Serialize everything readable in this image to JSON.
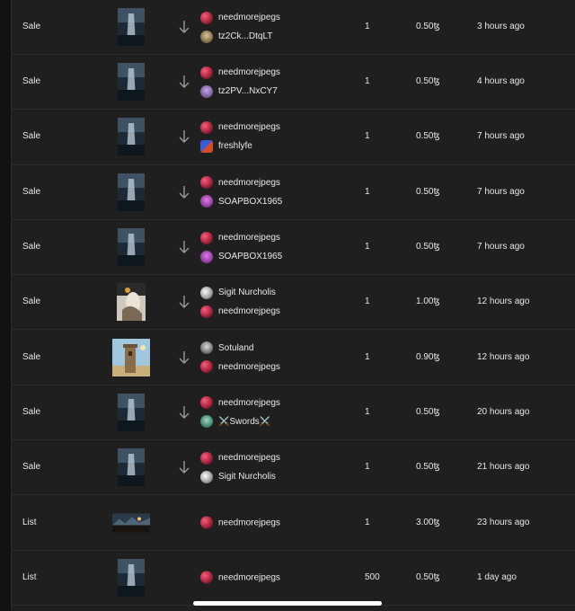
{
  "colors": {
    "background": "#1f1f1f",
    "text": "#e8e8e8",
    "divider": "#2e2e2e"
  },
  "rows": [
    {
      "event": "Sale",
      "artwork": "waterfall-artwork",
      "from": "needmorejpegs",
      "from_avatar": "av-need",
      "to": "tz2Ck...DtqLT",
      "to_avatar": "av-tz2ck",
      "qty": "1",
      "price": "0.50ꜩ",
      "time": "3 hours ago"
    },
    {
      "event": "Sale",
      "artwork": "waterfall-artwork",
      "from": "needmorejpegs",
      "from_avatar": "av-need",
      "to": "tz2PV...NxCY7",
      "to_avatar": "av-tz2pv",
      "qty": "1",
      "price": "0.50ꜩ",
      "time": "4 hours ago"
    },
    {
      "event": "Sale",
      "artwork": "waterfall-artwork",
      "from": "needmorejpegs",
      "from_avatar": "av-need",
      "to": "freshlyfe",
      "to_avatar": "av-fresh",
      "qty": "1",
      "price": "0.50ꜩ",
      "time": "7 hours ago"
    },
    {
      "event": "Sale",
      "artwork": "waterfall-artwork",
      "from": "needmorejpegs",
      "from_avatar": "av-need",
      "to": "SOAPBOX1965",
      "to_avatar": "av-soap",
      "qty": "1",
      "price": "0.50ꜩ",
      "time": "7 hours ago"
    },
    {
      "event": "Sale",
      "artwork": "waterfall-artwork",
      "from": "needmorejpegs",
      "from_avatar": "av-need",
      "to": "SOAPBOX1965",
      "to_avatar": "av-soap",
      "qty": "1",
      "price": "0.50ꜩ",
      "time": "7 hours ago"
    },
    {
      "event": "Sale",
      "artwork": "portrait-artwork",
      "from": "Sigit Nurcholis",
      "from_avatar": "av-sigit",
      "to": "needmorejpegs",
      "to_avatar": "av-need",
      "qty": "1",
      "price": "1.00ꜩ",
      "time": "12 hours ago"
    },
    {
      "event": "Sale",
      "artwork": "tower-artwork",
      "from": "Sotuland",
      "from_avatar": "av-sotu",
      "to": "needmorejpegs",
      "to_avatar": "av-need",
      "qty": "1",
      "price": "0.90ꜩ",
      "time": "12 hours ago"
    },
    {
      "event": "Sale",
      "artwork": "waterfall-artwork",
      "from": "needmorejpegs",
      "from_avatar": "av-need",
      "to": "⚔️Swords⚔️",
      "to_avatar": "av-swords",
      "qty": "1",
      "price": "0.50ꜩ",
      "time": "20 hours ago"
    },
    {
      "event": "Sale",
      "artwork": "waterfall-artwork",
      "from": "needmorejpegs",
      "from_avatar": "av-need",
      "to": "Sigit Nurcholis",
      "to_avatar": "av-sigit",
      "qty": "1",
      "price": "0.50ꜩ",
      "time": "21 hours ago"
    },
    {
      "event": "List",
      "artwork": "landscape-artwork",
      "from": "needmorejpegs",
      "from_avatar": "av-need",
      "to": "",
      "to_avatar": "",
      "qty": "1",
      "price": "3.00ꜩ",
      "time": "23 hours ago"
    },
    {
      "event": "List",
      "artwork": "waterfall-artwork",
      "from": "needmorejpegs",
      "from_avatar": "av-need",
      "to": "",
      "to_avatar": "",
      "qty": "500",
      "price": "0.50ꜩ",
      "time": "1 day ago"
    }
  ]
}
